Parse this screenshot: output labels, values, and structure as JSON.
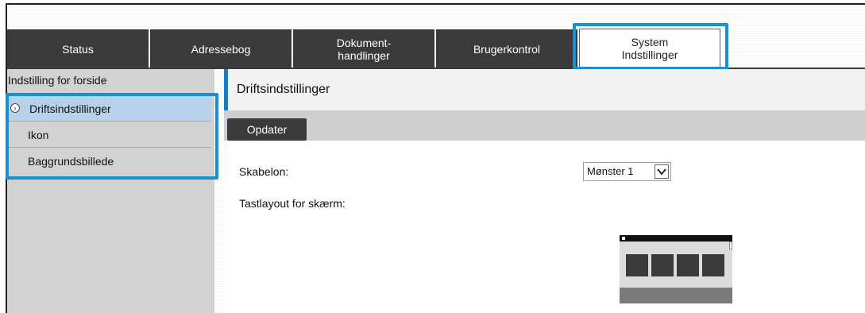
{
  "tabs": [
    {
      "label": "Status"
    },
    {
      "label": "Adressebog"
    },
    {
      "label": "Dokument-\nhandlinger"
    },
    {
      "label": "Brugerkontrol"
    },
    {
      "label": "System\nIndstillinger"
    }
  ],
  "sidebar": {
    "header": "Indstilling for forside",
    "items": [
      {
        "label": "Driftsindstillinger",
        "selected": true
      },
      {
        "label": "Ikon"
      },
      {
        "label": "Baggrundsbillede"
      }
    ]
  },
  "main": {
    "title": "Driftsindstillinger",
    "update_button": "Opdater",
    "template_label": "Skabelon:",
    "template_value": "Mønster 1",
    "layout_label": "Tastlayout for skærm:"
  },
  "colors": {
    "highlight": "#1a8fd4",
    "accent": "#1f78c4",
    "tab_bg": "#3a3a3a"
  }
}
